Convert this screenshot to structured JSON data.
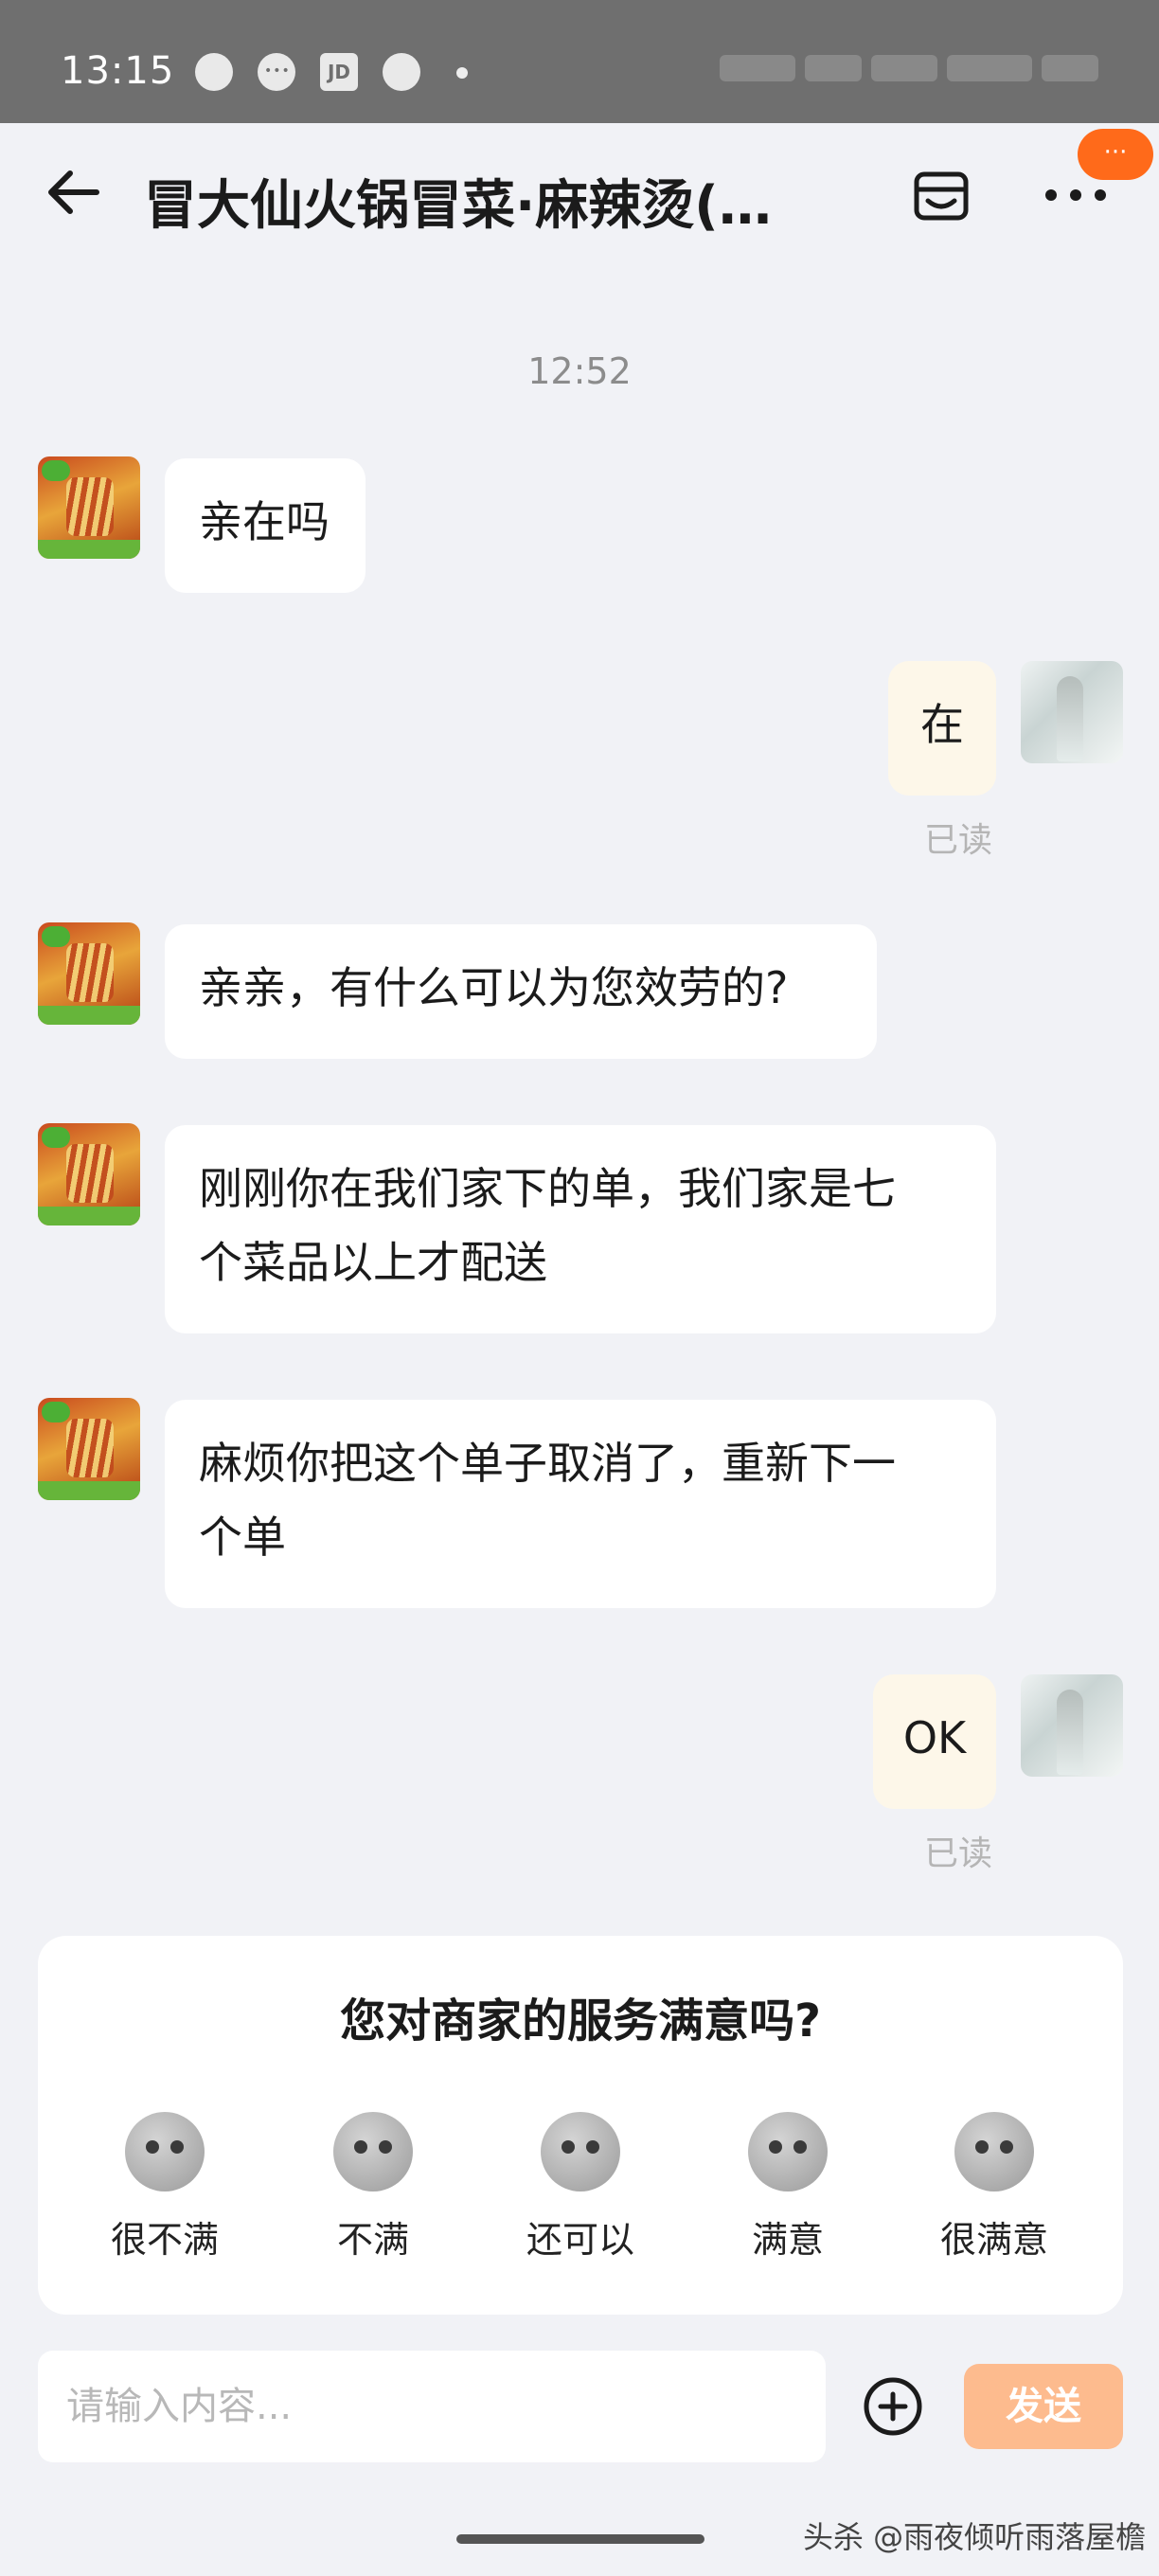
{
  "status_bar": {
    "time": "13:15",
    "jd_label": "JD"
  },
  "header": {
    "title": "冒大仙火锅冒菜·麻辣烫(…",
    "badge": "···",
    "icons": [
      "back-arrow-icon",
      "shop-icon",
      "more-icon"
    ]
  },
  "chat": {
    "timestamp": "12:52",
    "messages": [
      {
        "from": "merchant",
        "text": "亲在吗"
      },
      {
        "from": "me",
        "text": "在",
        "status": "已读"
      },
      {
        "from": "merchant",
        "text": "亲亲，有什么可以为您效劳的?"
      },
      {
        "from": "merchant",
        "line1": "刚刚你在我们家下的单，我们家是七",
        "line2": "个菜品以上才配送"
      },
      {
        "from": "merchant",
        "line1": "麻烦你把这个单子取消了，重新下一",
        "line2": "个单"
      },
      {
        "from": "me",
        "text": "OK",
        "status": "已读"
      }
    ]
  },
  "survey": {
    "question": "您对商家的服务满意吗?",
    "options": [
      {
        "label": "很不满",
        "icon": "very-dissatisfied-face-icon"
      },
      {
        "label": "不满",
        "icon": "dissatisfied-face-icon"
      },
      {
        "label": "还可以",
        "icon": "neutral-face-icon"
      },
      {
        "label": "满意",
        "icon": "satisfied-face-icon"
      },
      {
        "label": "很满意",
        "icon": "very-satisfied-face-icon"
      }
    ]
  },
  "composer": {
    "placeholder": "请输入内容...",
    "send_label": "发送"
  },
  "watermark": "头杀 @雨夜倾听雨落屋檐",
  "colors": {
    "accent": "#ff6a1a",
    "send_button": "#fdbb8e",
    "my_bubble": "#fdf7e9",
    "background": "#f1f2f6"
  }
}
